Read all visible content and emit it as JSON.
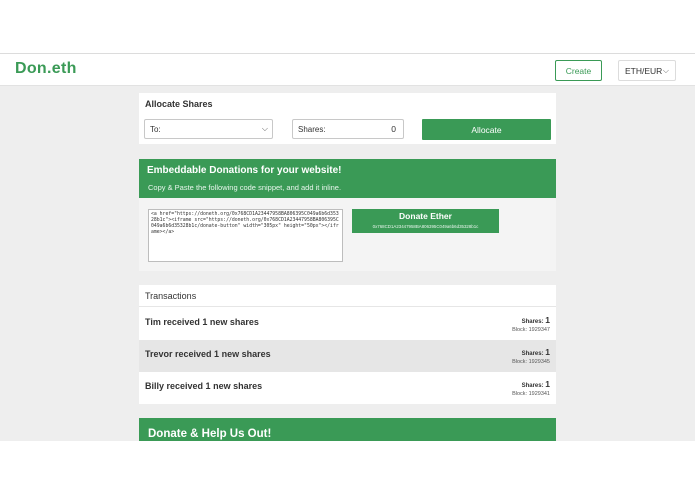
{
  "app": {
    "logo": "Don.eth",
    "create_label": "Create",
    "currency": "ETH/EUR"
  },
  "allocate": {
    "title": "Allocate Shares",
    "to_label": "To:",
    "shares_label": "Shares:",
    "shares_value": "0",
    "button_label": "Allocate"
  },
  "embed": {
    "title": "Embeddable Donations for your website!",
    "subtitle": "Copy & Paste the following code snippet, and add it inline.",
    "code": "<a href=\"https://doneth.org/0x768CD1A23447958BA806395C049a6b6d35328b1c\"><iframe src=\"https://doneth.org/0x768CD1A23447958BA806395C049a6b6d35328b1c/donate-button\" width=\"305px\" height=\"50px\"></iframe></a>",
    "donate_label": "Donate Ether",
    "donate_address": "0x768CD1A23447958BA806395C049a6b6d35328b1c"
  },
  "transactions": {
    "title": "Transactions",
    "shares_label": "Shares:",
    "rows": [
      {
        "name": "Tim",
        "text": "received 1 new shares",
        "shares": "1",
        "block": "Block: 1929347"
      },
      {
        "name": "Trevor",
        "text": "received 1 new shares",
        "shares": "1",
        "block": "Block: 1929345"
      },
      {
        "name": "Billy",
        "text": "received 1 new shares",
        "shares": "1",
        "block": "Block: 1929341"
      }
    ]
  },
  "donate_help": {
    "title": "Donate & Help Us Out!"
  },
  "colors": {
    "brand_green": "#3a9a56",
    "background": "#eeeeee"
  }
}
